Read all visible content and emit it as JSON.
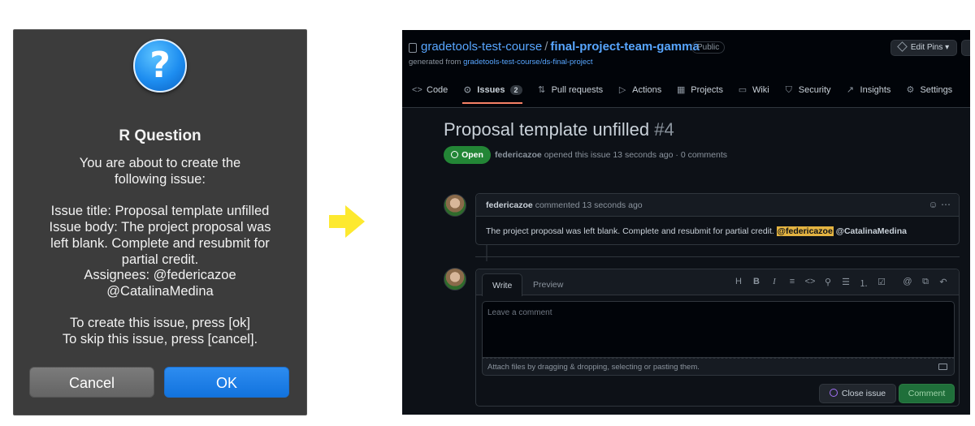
{
  "dialog": {
    "title": "R Question",
    "icon": "question-icon",
    "lines": [
      "You are about to create the",
      "following issue:",
      "Issue title: Proposal template unfilled",
      "Issue body: The project proposal was",
      "left blank. Complete and resubmit for",
      "partial credit.",
      "Assignees: @federicazoe",
      "@CatalinaMedina",
      "To create this issue, press [ok]",
      "To skip this issue, press [cancel]."
    ],
    "cancel_label": "Cancel",
    "ok_label": "OK"
  },
  "arrow": {
    "icon": "arrow-right-icon",
    "color": "#fde92f"
  },
  "github": {
    "owner": "gradetools-test-course",
    "separator": "/",
    "repo": "final-project-team-gamma",
    "visibility": "Public",
    "generated_prefix": "generated from",
    "generated_link": "gradetools-test-course/ds-final-project",
    "edit_pins_label": "Edit Pins",
    "tabs": [
      {
        "label": "Code",
        "icon": "code-icon",
        "glyph": "<>"
      },
      {
        "label": "Issues",
        "icon": "issue-icon",
        "glyph": "⊙",
        "count": "2",
        "active": true
      },
      {
        "label": "Pull requests",
        "icon": "pull-request-icon",
        "glyph": "⇅"
      },
      {
        "label": "Actions",
        "icon": "play-icon",
        "glyph": "▷"
      },
      {
        "label": "Projects",
        "icon": "table-icon",
        "glyph": "▦"
      },
      {
        "label": "Wiki",
        "icon": "book-icon",
        "glyph": "▭"
      },
      {
        "label": "Security",
        "icon": "shield-icon",
        "glyph": "⛉"
      },
      {
        "label": "Insights",
        "icon": "graph-icon",
        "glyph": "↗"
      },
      {
        "label": "Settings",
        "icon": "gear-icon",
        "glyph": "⚙"
      }
    ],
    "issue": {
      "title": "Proposal template unfilled",
      "number": "#4",
      "status": "Open",
      "author": "federicazoe",
      "meta_rest": "opened this issue 13 seconds ago · 0 comments"
    },
    "comment": {
      "author": "federicazoe",
      "meta": "commented 13 seconds ago",
      "body": "The project proposal was left blank. Complete and resubmit for partial credit.",
      "mention_1": "@federicazoe",
      "mention_2": "@CatalinaMedina"
    },
    "editor": {
      "write_tab": "Write",
      "preview_tab": "Preview",
      "placeholder": "Leave a comment",
      "attach_hint": "Attach files by dragging & dropping, selecting or pasting them.",
      "close_issue_label": "Close issue",
      "comment_label": "Comment",
      "toolbar": [
        {
          "icon": "heading-icon",
          "glyph": "H"
        },
        {
          "icon": "bold-icon",
          "glyph": "B"
        },
        {
          "icon": "italic-icon",
          "glyph": "I"
        },
        {
          "icon": "quote-icon",
          "glyph": "≡"
        },
        {
          "icon": "code-icon",
          "glyph": "<>"
        },
        {
          "icon": "link-icon",
          "glyph": "⚲"
        },
        {
          "icon": "unordered-list-icon",
          "glyph": "☰"
        },
        {
          "icon": "ordered-list-icon",
          "glyph": "⒈"
        },
        {
          "icon": "task-list-icon",
          "glyph": "☑"
        },
        {
          "icon": "mention-icon",
          "glyph": "@"
        },
        {
          "icon": "reference-icon",
          "glyph": "⧉"
        },
        {
          "icon": "reply-icon",
          "glyph": "↶"
        }
      ]
    }
  }
}
